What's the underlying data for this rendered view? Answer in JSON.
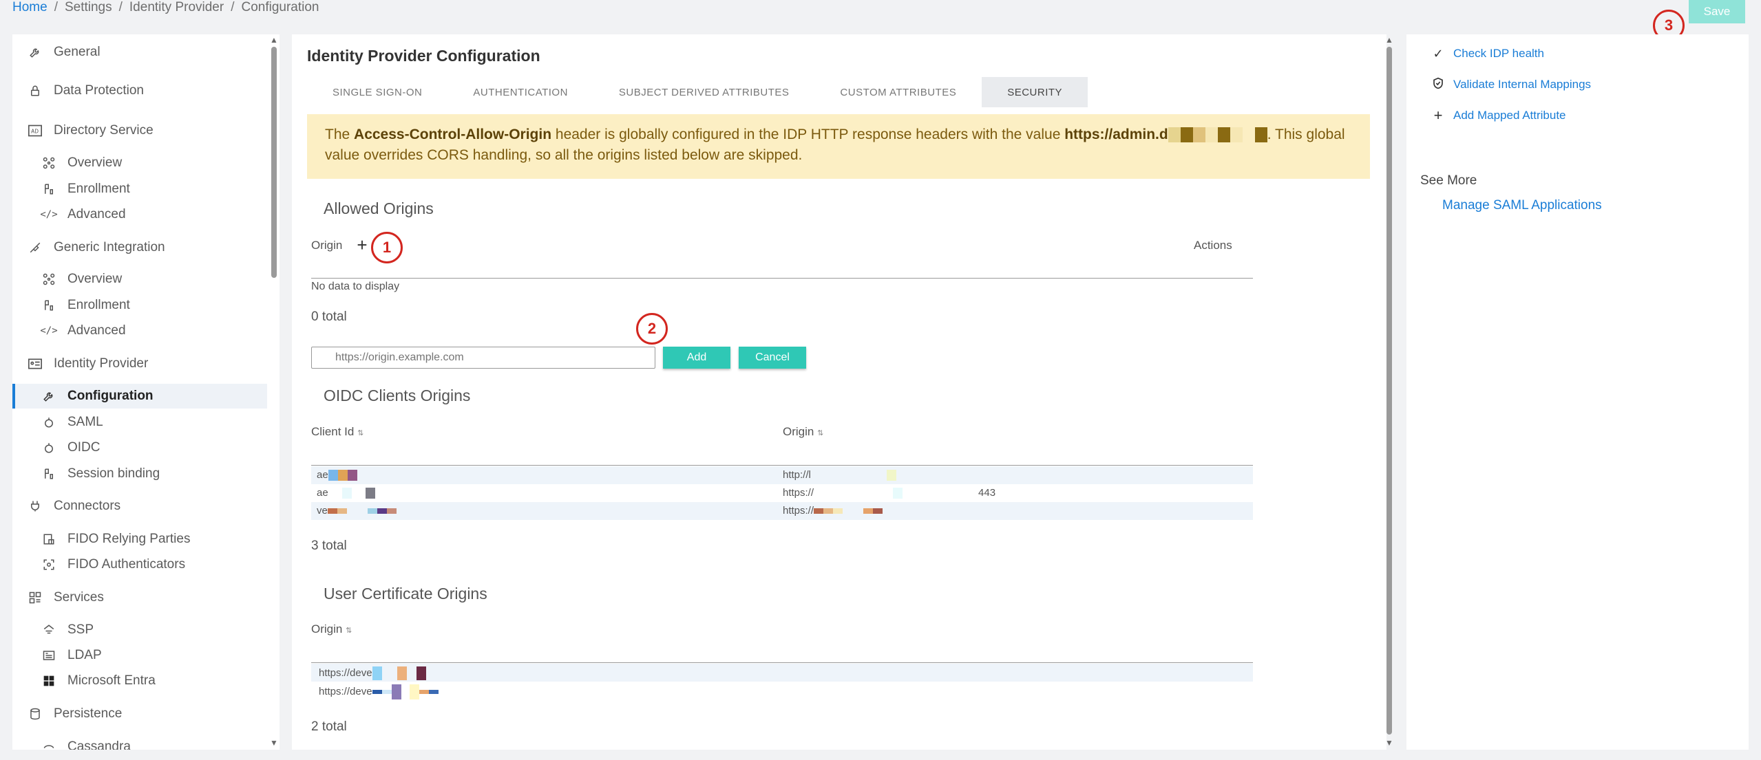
{
  "breadcrumb": {
    "items": [
      "Home",
      "Settings",
      "Identity Provider",
      "Configuration"
    ],
    "separator": "/"
  },
  "header": {
    "save_label": "Save"
  },
  "markers": [
    "1",
    "2",
    "3"
  ],
  "sidebar": {
    "items": [
      {
        "label": "General",
        "icon": "wrench-icon"
      },
      {
        "label": "Data Protection",
        "icon": "lock-icon"
      },
      {
        "label": "Directory Service",
        "icon": "directory-ad-icon"
      },
      {
        "label": "Overview",
        "icon": "network-icon"
      },
      {
        "label": "Enrollment",
        "icon": "enrollment-icon"
      },
      {
        "label": "Advanced",
        "icon": "code-icon"
      },
      {
        "label": "Generic Integration",
        "icon": "integration-icon"
      },
      {
        "label": "Overview",
        "icon": "network-icon"
      },
      {
        "label": "Enrollment",
        "icon": "enrollment-icon"
      },
      {
        "label": "Advanced",
        "icon": "code-icon"
      },
      {
        "label": "Identity Provider",
        "icon": "id-card-icon"
      },
      {
        "label": "Configuration",
        "icon": "wrench-icon"
      },
      {
        "label": "SAML",
        "icon": "saml-icon"
      },
      {
        "label": "OIDC",
        "icon": "oidc-icon"
      },
      {
        "label": "Session binding",
        "icon": "session-binding-icon"
      },
      {
        "label": "Connectors",
        "icon": "plug-icon"
      },
      {
        "label": "FIDO Relying Parties",
        "icon": "fido-lock-icon"
      },
      {
        "label": "FIDO Authenticators",
        "icon": "fido-scan-icon"
      },
      {
        "label": "Services",
        "icon": "services-grid-icon"
      },
      {
        "label": "SSP",
        "icon": "ssp-icon"
      },
      {
        "label": "LDAP",
        "icon": "ldap-icon"
      },
      {
        "label": "Microsoft Entra",
        "icon": "windows-icon"
      },
      {
        "label": "Persistence",
        "icon": "database-icon"
      },
      {
        "label": "Cassandra",
        "icon": "cassandra-icon"
      }
    ],
    "active": "Configuration"
  },
  "main": {
    "title": "Identity Provider Configuration",
    "tabs": [
      "SINGLE SIGN-ON",
      "AUTHENTICATION",
      "SUBJECT DERIVED ATTRIBUTES",
      "CUSTOM ATTRIBUTES",
      "SECURITY"
    ],
    "active_tab": "SECURITY",
    "alert": {
      "prefix": "The ",
      "header_name": "Access-Control-Allow-Origin",
      "middle": " header is globally configured in the IDP HTTP response headers with the value ",
      "value": "https://admin.d",
      "suffix": ". This global value overrides CORS handling, so all the origins listed below are skipped."
    },
    "allowed_origins": {
      "title": "Allowed Origins",
      "col_origin": "Origin",
      "col_actions": "Actions",
      "empty": "No data to display",
      "total": "0 total",
      "input_placeholder": "https://origin.example.com",
      "add_label": "Add",
      "cancel_label": "Cancel"
    },
    "oidc_origins": {
      "title": "OIDC Clients Origins",
      "col_client": "Client Id",
      "col_origin": "Origin",
      "rows": [
        {
          "client": "ae",
          "origin": "http://l",
          "port": ""
        },
        {
          "client": "ae",
          "origin": "https://",
          "port": "443"
        },
        {
          "client": "ve",
          "origin": "https://",
          "port": ""
        }
      ],
      "total": "3 total"
    },
    "cert_origins": {
      "title": "User Certificate Origins",
      "col_origin": "Origin",
      "rows": [
        {
          "origin": "https://deve"
        },
        {
          "origin": "https://deve"
        }
      ],
      "total": "2 total"
    }
  },
  "right": {
    "links": [
      {
        "label": "Check IDP health",
        "icon": "check-icon"
      },
      {
        "label": "Validate Internal Mappings",
        "icon": "shield-check-icon"
      },
      {
        "label": "Add Mapped Attribute",
        "icon": "plus-icon"
      }
    ],
    "see_more": "See More",
    "saml_link": "Manage SAML Applications"
  }
}
